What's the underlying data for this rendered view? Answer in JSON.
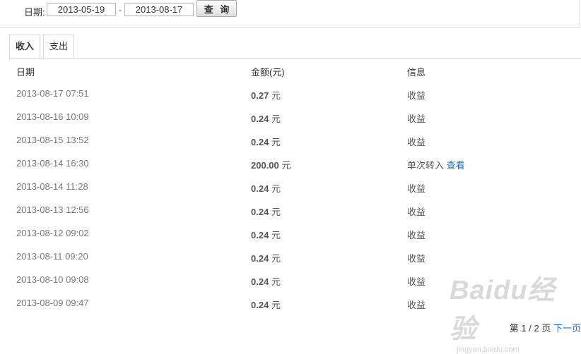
{
  "filter": {
    "date_label": "日期:",
    "start_date": "2013-05-19",
    "separator": "-",
    "end_date": "2013-08-17",
    "query_label": "查 询"
  },
  "tabs": [
    {
      "label": "收入",
      "active": true
    },
    {
      "label": "支出",
      "active": false
    }
  ],
  "columns": {
    "date": "日期",
    "amount": "金额(元)",
    "info": "信息"
  },
  "currency_unit": "元",
  "rows": [
    {
      "date": "2013-08-17 07:51",
      "amount": "0.27",
      "info": "收益"
    },
    {
      "date": "2013-08-16 10:09",
      "amount": "0.24",
      "info": "收益"
    },
    {
      "date": "2013-08-15 13:52",
      "amount": "0.24",
      "info": "收益"
    },
    {
      "date": "2013-08-14 16:30",
      "amount": "200.00",
      "info": "单次转入",
      "link": "查看"
    },
    {
      "date": "2013-08-14 11:28",
      "amount": "0.24",
      "info": "收益"
    },
    {
      "date": "2013-08-13 12:56",
      "amount": "0.24",
      "info": "收益"
    },
    {
      "date": "2013-08-12 09:02",
      "amount": "0.24",
      "info": "收益"
    },
    {
      "date": "2013-08-11 09:20",
      "amount": "0.24",
      "info": "收益"
    },
    {
      "date": "2013-08-10 09:08",
      "amount": "0.24",
      "info": "收益"
    },
    {
      "date": "2013-08-09 09:47",
      "amount": "0.24",
      "info": "收益"
    }
  ],
  "pager": {
    "prefix": "第",
    "current": "1",
    "sep": "/",
    "total": "2",
    "suffix": "页",
    "next_label": "下一页"
  },
  "watermark": {
    "logo": "Baidu经验",
    "url": "jingyan.baidu.com"
  }
}
